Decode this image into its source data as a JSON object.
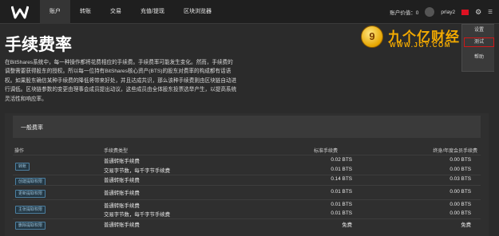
{
  "nav": {
    "items": [
      "账户",
      "转账",
      "交易",
      "充值/提现",
      "区块浏览器"
    ]
  },
  "header_right": {
    "account_value_label": "账户价值：0",
    "username": "prlay2"
  },
  "dropdown": {
    "items": [
      "设置",
      "测试",
      "帮助"
    ]
  },
  "watermark": {
    "coin_glyph": "9",
    "title": "九个亿财经",
    "url": "WWW.JGY.COM"
  },
  "page": {
    "title": "手续费率",
    "intro": "在BitShares系统中，每一种操作都将花费相应的手续费。手续费率可能发生变化。然而，手续费的调整需要获得股东的授权。所以每一位持有BitShares核心资产(BTS)的股东对费率的构成都有话语权。如果股东确信某种手续费的降低将带来好处，并且达成共识，那么该种手续费则由区块链自动进行调低。区块链参数的变更由理事会成员提出动议，这些成员由全体股东投票选举产生，以提高系统灵活性和响应率。"
  },
  "fees": {
    "section_title": "一般费率",
    "headers": {
      "operation": "操作",
      "fee_type": "手续费类型",
      "standard": "标准手续费",
      "ltm": "终身/年度会员手续费"
    },
    "buttons": [
      "转账",
      "创建提取权限",
      "更新提取权限",
      "主张提取权限",
      "删除提取权限"
    ],
    "rows": [
      {
        "type": "普通转账手续费",
        "standard": "0.02 BTS",
        "ltm": "0.00 BTS"
      },
      {
        "type": "交易字节数，每千字节手续费",
        "standard": "0.01 BTS",
        "ltm": "0.00 BTS"
      },
      {
        "type": "普通转账手续费",
        "standard": "0.14 BTS",
        "ltm": "0.03 BTS"
      },
      {
        "type": "普通转账手续费",
        "standard": "0.01 BTS",
        "ltm": "0.00 BTS"
      },
      {
        "type": "普通转账手续费",
        "standard": "0.01 BTS",
        "ltm": "0.00 BTS"
      },
      {
        "type": "交易字节数，每千字节手续费",
        "standard": "0.01 BTS",
        "ltm": "0.00 BTS"
      },
      {
        "type": "普通转账手续费",
        "standard": "免费",
        "ltm": "免费"
      }
    ]
  },
  "colors": {
    "background": "#2b2b2b",
    "topbar": "#1f1f1f",
    "watermark": "#f2a900",
    "highlight_box": "#d01818",
    "op_button_border": "#4c7fa0"
  }
}
